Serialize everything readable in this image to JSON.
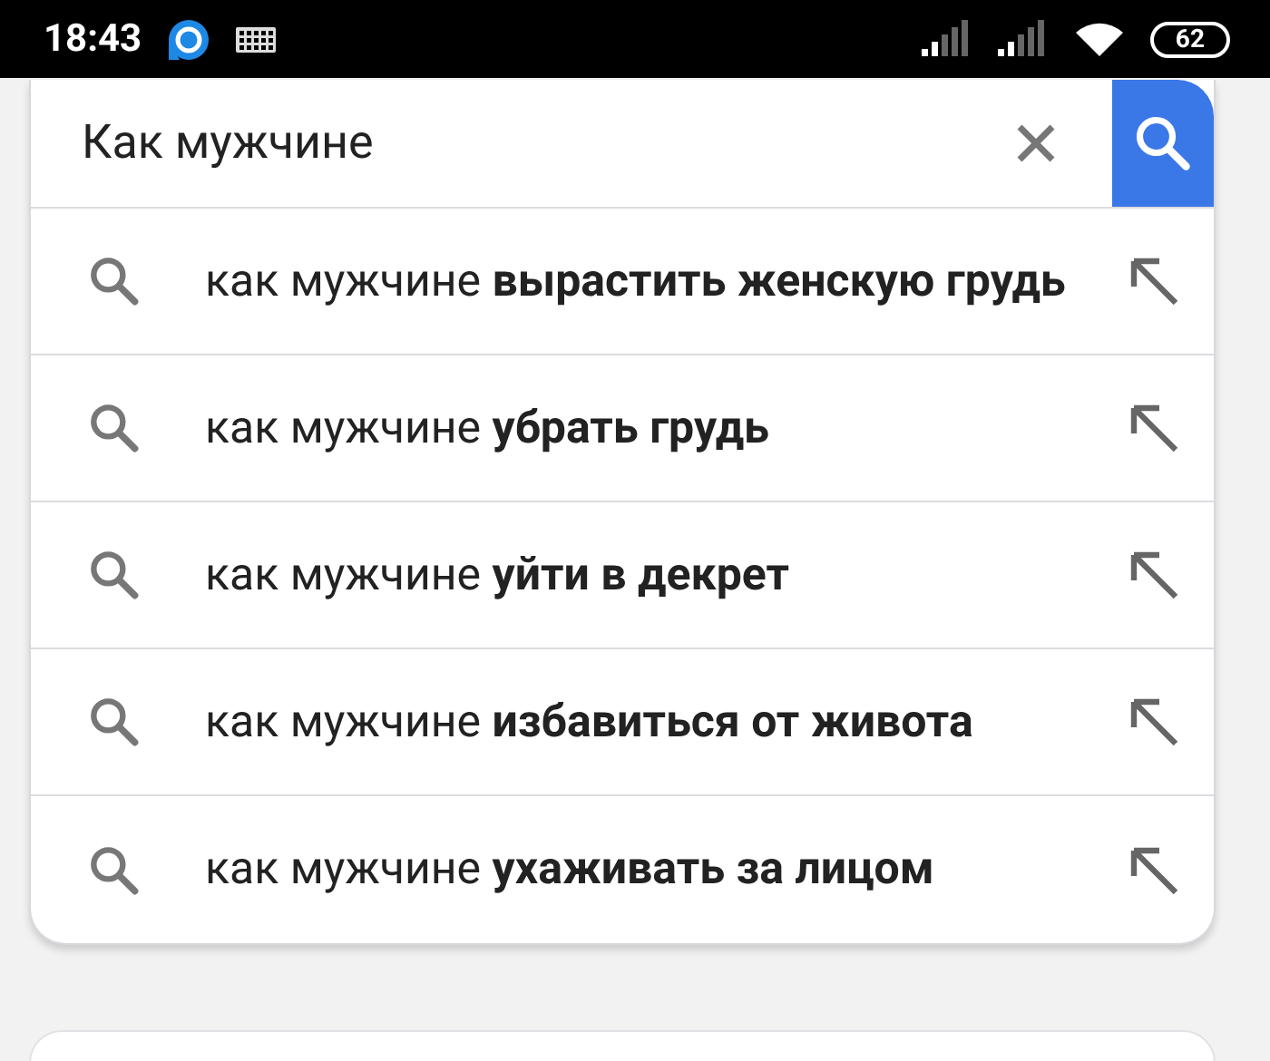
{
  "status_bar": {
    "time": "18:43",
    "battery": "62"
  },
  "search": {
    "value": "Как мужчине"
  },
  "suggestions": [
    {
      "text": "как мужчине **вырастить женскую грудь**"
    },
    {
      "text": "как мужчине **убрать грудь**"
    },
    {
      "text": "как мужчине **уйти в декрет**"
    },
    {
      "text": "как мужчине **избавиться от живота**"
    },
    {
      "text": "как мужчине **ухаживать за лицом**"
    }
  ]
}
